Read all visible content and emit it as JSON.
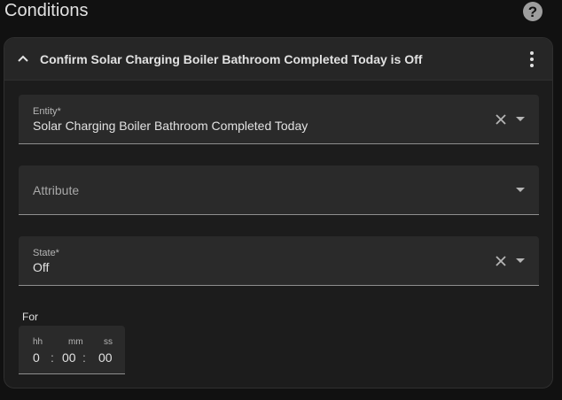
{
  "section": {
    "title": "Conditions",
    "help_icon": "help-circle-icon",
    "help_glyph": "?"
  },
  "condition": {
    "title": "Confirm Solar Charging Boiler Bathroom Completed Today is Off",
    "collapse_icon": "chevron-up-icon",
    "menu_icon": "dots-vertical-icon"
  },
  "entity_field": {
    "label": "Entity*",
    "value": "Solar Charging Boiler Bathroom Completed Today"
  },
  "attribute_field": {
    "placeholder": "Attribute"
  },
  "state_field": {
    "label": "State*",
    "value": "Off"
  },
  "for_duration": {
    "label": "For",
    "hh_label": "hh",
    "mm_label": "mm",
    "ss_label": "ss",
    "hh": "0",
    "mm": "00",
    "ss": "00",
    "separator": ":"
  },
  "colors": {
    "background": "#111111",
    "card": "#1c1c1c",
    "field": "#2a2a2a",
    "text": "#e1e1e1"
  }
}
